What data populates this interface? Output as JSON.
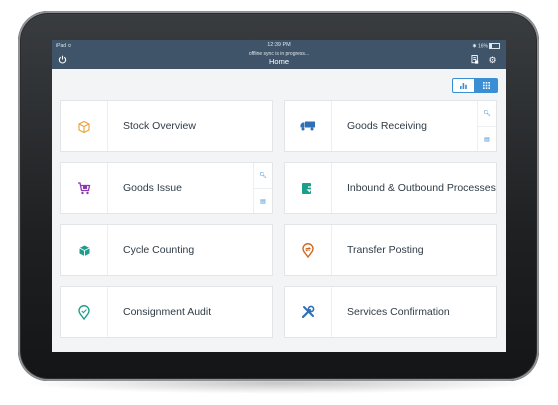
{
  "status_bar": {
    "carrier": "iPad ≎",
    "time": "12:39 PM",
    "battery": "✱ 16%"
  },
  "header": {
    "sync_status": "offline sync is in progress...",
    "title": "Home"
  },
  "tiles": [
    {
      "label": "Stock Overview"
    },
    {
      "label": "Goods Receiving"
    },
    {
      "label": "Goods Issue"
    },
    {
      "label": "Inbound & Outbound Processes"
    },
    {
      "label": "Cycle Counting"
    },
    {
      "label": "Transfer Posting"
    },
    {
      "label": "Consignment Audit"
    },
    {
      "label": "Services Confirmation"
    }
  ],
  "colors": {
    "header_bg": "#3f5468",
    "accent": "#3a8ed4",
    "stock_icon": "#e8a23a",
    "receiving_icon": "#2f6fb5",
    "issue_icon": "#8a3ab0",
    "inout_icon": "#1e9e8a",
    "cycle_icon": "#1e9e8a",
    "transfer_icon": "#d0671e",
    "consignment_icon": "#1e9e8a",
    "services_icon": "#2f6fb5"
  }
}
